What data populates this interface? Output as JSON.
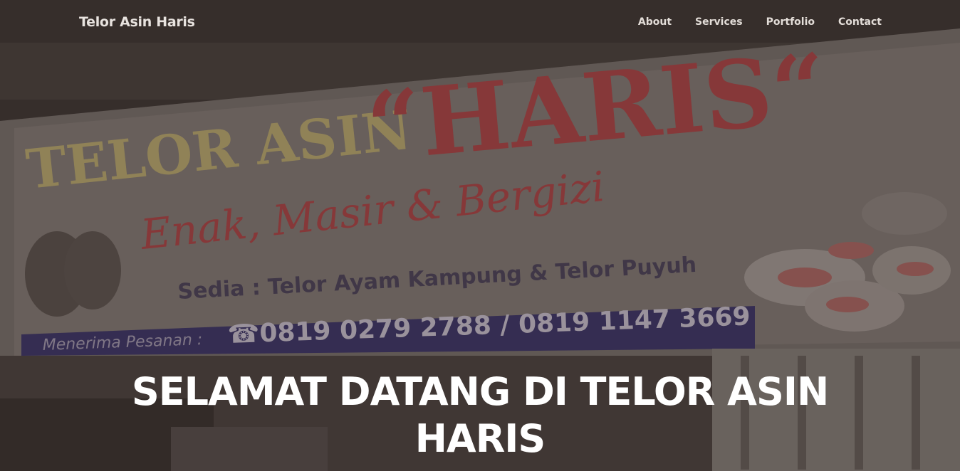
{
  "navbar": {
    "brand": "Telor Asin Haris",
    "links": [
      "About",
      "Services",
      "Portfolio",
      "Contact"
    ]
  },
  "hero": {
    "headline_line1": "SELAMAT DATANG DI TELOR ASIN",
    "headline_line2": "HARIS"
  },
  "banner": {
    "title_left": "TELOR ASIN",
    "title_right": "“HARIS“",
    "tagline": "Enak, Masir & Bergizi",
    "offer": "Sedia : Telor Ayam Kampung & Telor Puyuh",
    "orders_label": "Menerima Pesanan :",
    "phones": "☎0819 0279 2788 / 0819 1147 3669",
    "colors": {
      "banner_bg": "#8c8580",
      "yellow_text": "#c8b878",
      "red_text": "#b8484a",
      "phone_band": "#3d3770"
    }
  }
}
